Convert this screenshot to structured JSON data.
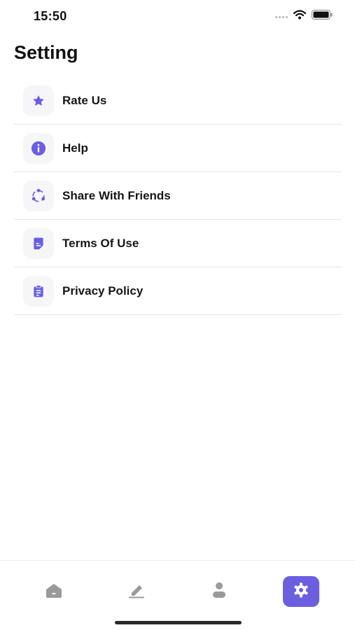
{
  "status_bar": {
    "time": "15:50"
  },
  "page": {
    "title": "Setting"
  },
  "settings": {
    "items": [
      {
        "label": "Rate Us",
        "icon": "star-icon"
      },
      {
        "label": "Help",
        "icon": "info-icon"
      },
      {
        "label": "Share With Friends",
        "icon": "share-icon"
      },
      {
        "label": "Terms Of Use",
        "icon": "document-icon"
      },
      {
        "label": "Privacy Policy",
        "icon": "clipboard-icon"
      }
    ]
  },
  "tab_bar": {
    "tabs": [
      {
        "icon": "home-icon",
        "active": false
      },
      {
        "icon": "edit-icon",
        "active": false
      },
      {
        "icon": "user-icon",
        "active": false
      },
      {
        "icon": "gear-icon",
        "active": true
      }
    ]
  },
  "colors": {
    "accent": "#6b5fe0",
    "icon_bg": "#f6f6f8",
    "inactive_icon": "#9a9a9a",
    "divider": "#e4e4e4"
  }
}
